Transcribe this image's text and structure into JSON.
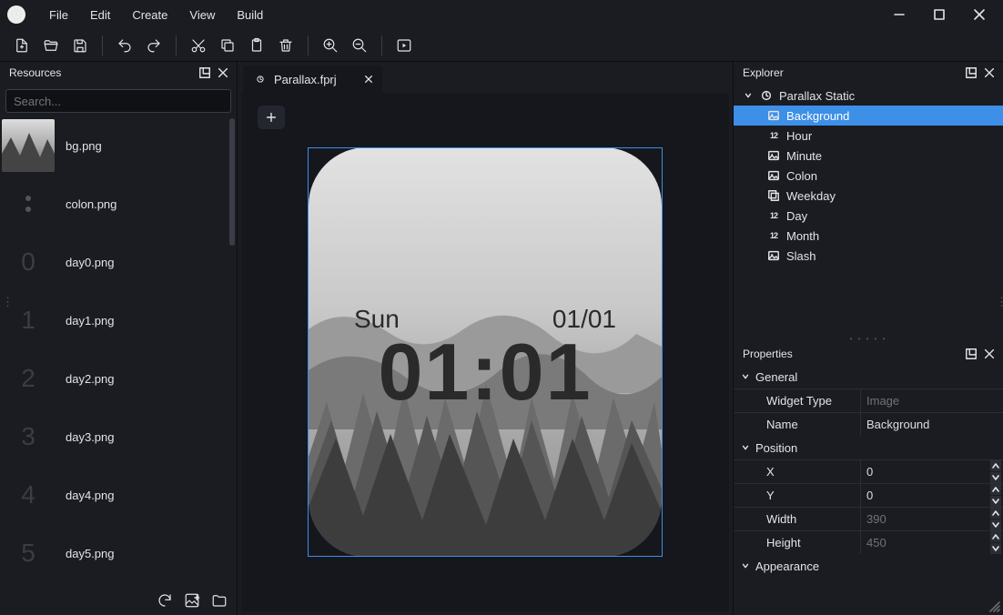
{
  "menu": {
    "file": "File",
    "edit": "Edit",
    "create": "Create",
    "view": "View",
    "build": "Build"
  },
  "resources": {
    "title": "Resources",
    "search_placeholder": "Search...",
    "items": [
      {
        "label": "bg.png"
      },
      {
        "label": "colon.png"
      },
      {
        "label": "day0.png"
      },
      {
        "label": "day1.png"
      },
      {
        "label": "day2.png"
      },
      {
        "label": "day3.png"
      },
      {
        "label": "day4.png"
      },
      {
        "label": "day5.png"
      }
    ]
  },
  "tab": {
    "label": "Parallax.fprj"
  },
  "watchface": {
    "weekday": "Sun",
    "date": "01/01",
    "time": "01:01"
  },
  "explorer": {
    "title": "Explorer",
    "root": "Parallax Static",
    "items": [
      {
        "label": "Background",
        "icon": "image",
        "selected": true
      },
      {
        "label": "Hour",
        "icon": "num"
      },
      {
        "label": "Minute",
        "icon": "image"
      },
      {
        "label": "Colon",
        "icon": "image"
      },
      {
        "label": "Weekday",
        "icon": "layer"
      },
      {
        "label": "Day",
        "icon": "num"
      },
      {
        "label": "Month",
        "icon": "num"
      },
      {
        "label": "Slash",
        "icon": "image"
      }
    ]
  },
  "properties": {
    "title": "Properties",
    "general": {
      "header": "General",
      "widget_type_label": "Widget Type",
      "widget_type": "Image",
      "name_label": "Name",
      "name": "Background"
    },
    "position": {
      "header": "Position",
      "x_label": "X",
      "x": "0",
      "y_label": "Y",
      "y": "0",
      "width_label": "Width",
      "width": "390",
      "height_label": "Height",
      "height": "450"
    },
    "appearance": {
      "header": "Appearance"
    }
  }
}
